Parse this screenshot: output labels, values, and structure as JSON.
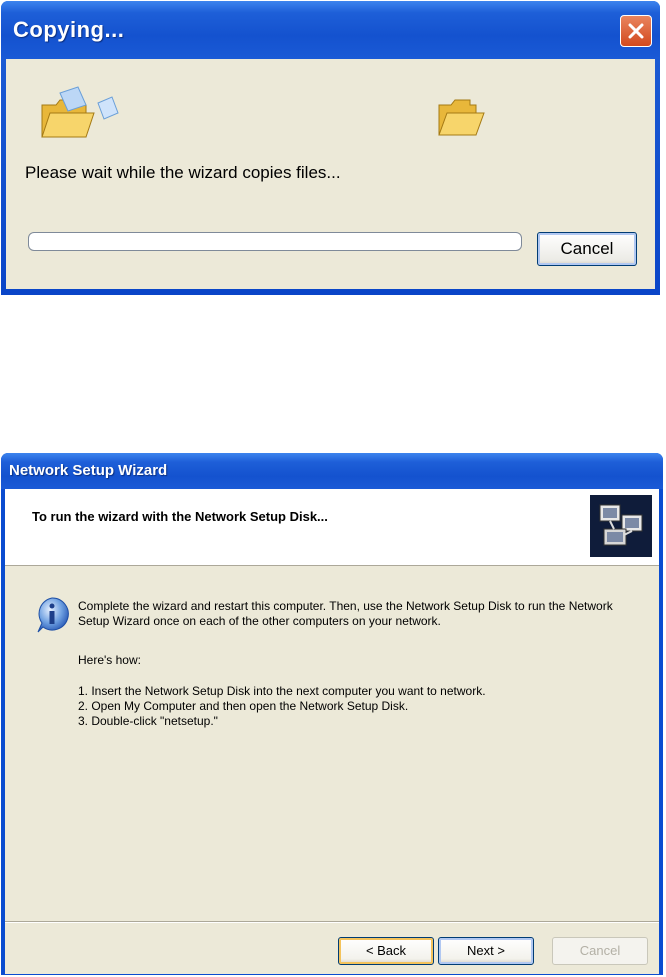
{
  "copy_dialog": {
    "title": "Copying...",
    "message": "Please wait while the wizard copies files...",
    "progress_percent": 0,
    "cancel_label": "Cancel",
    "icons": [
      "flying-document-folder-icon",
      "destination-folder-icon",
      "close-icon"
    ]
  },
  "wizard": {
    "title": "Network Setup Wizard",
    "heading": "To run the wizard with the Network Setup Disk...",
    "intro": "Complete the wizard and restart this computer. Then, use the Network Setup Disk to run the Network Setup Wizard once on each of the other computers on your network.",
    "how_label": "Here's how:",
    "steps": [
      "1.  Insert the Network Setup Disk into the next computer you want to network.",
      "2.  Open My Computer and then open the Network Setup Disk.",
      "3.  Double-click \"netsetup.\""
    ],
    "buttons": {
      "back": "< Back",
      "next": "Next >",
      "cancel": "Cancel"
    },
    "icons": [
      "network-computers-icon",
      "info-icon"
    ]
  }
}
